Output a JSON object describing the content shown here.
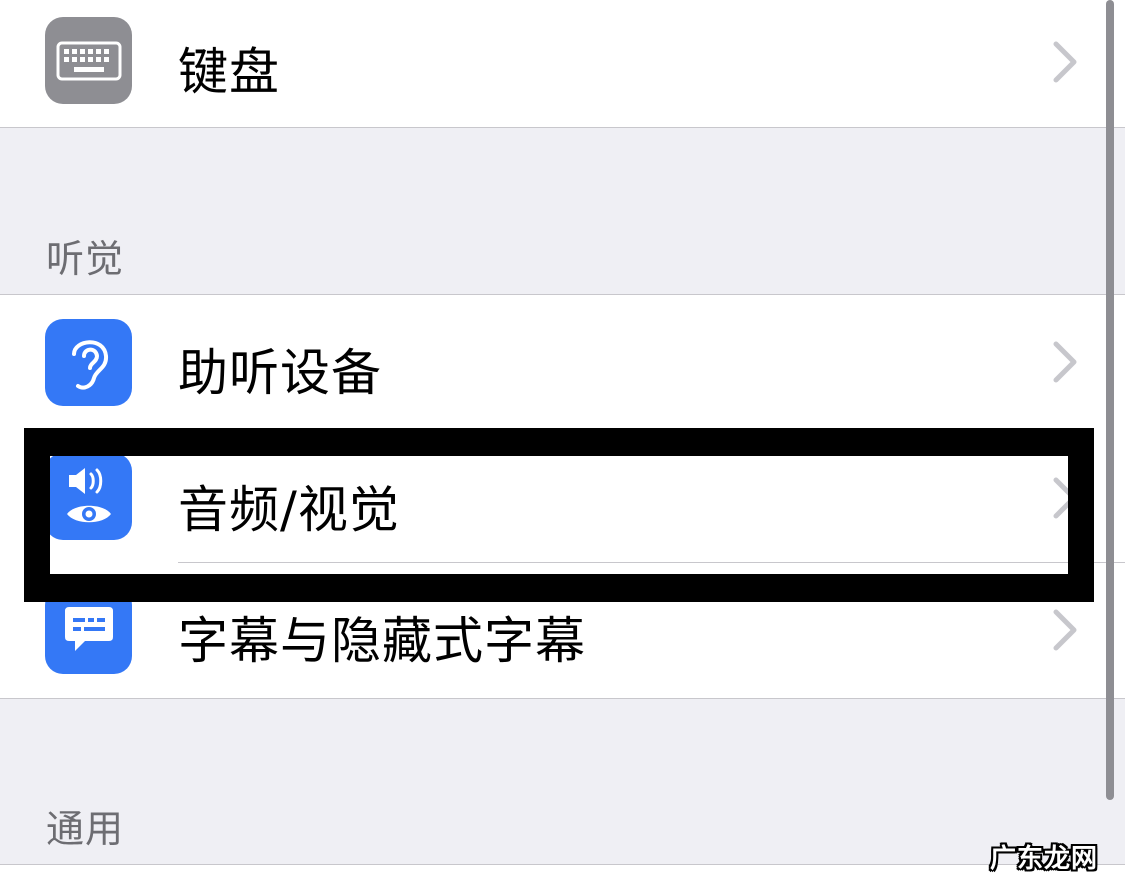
{
  "rows": {
    "keyboard": {
      "label": "键盘",
      "icon": "keyboard-icon",
      "icon_bg": "#8e8e93"
    },
    "hearing_devices": {
      "label": "助听设备",
      "icon": "ear-icon",
      "icon_bg": "#3478f6"
    },
    "audio_visual": {
      "label": "音频/视觉",
      "icon": "speaker-eye-icon",
      "icon_bg": "#3478f6"
    },
    "captions": {
      "label": "字幕与隐藏式字幕",
      "icon": "caption-bubble-icon",
      "icon_bg": "#3478f6"
    }
  },
  "sections": {
    "hearing": "听觉",
    "general": "通用"
  },
  "watermark": "广东龙网",
  "colors": {
    "background": "#efeff4",
    "accent_blue": "#3478f6",
    "gray_icon": "#8e8e93",
    "highlight": "#000000"
  }
}
